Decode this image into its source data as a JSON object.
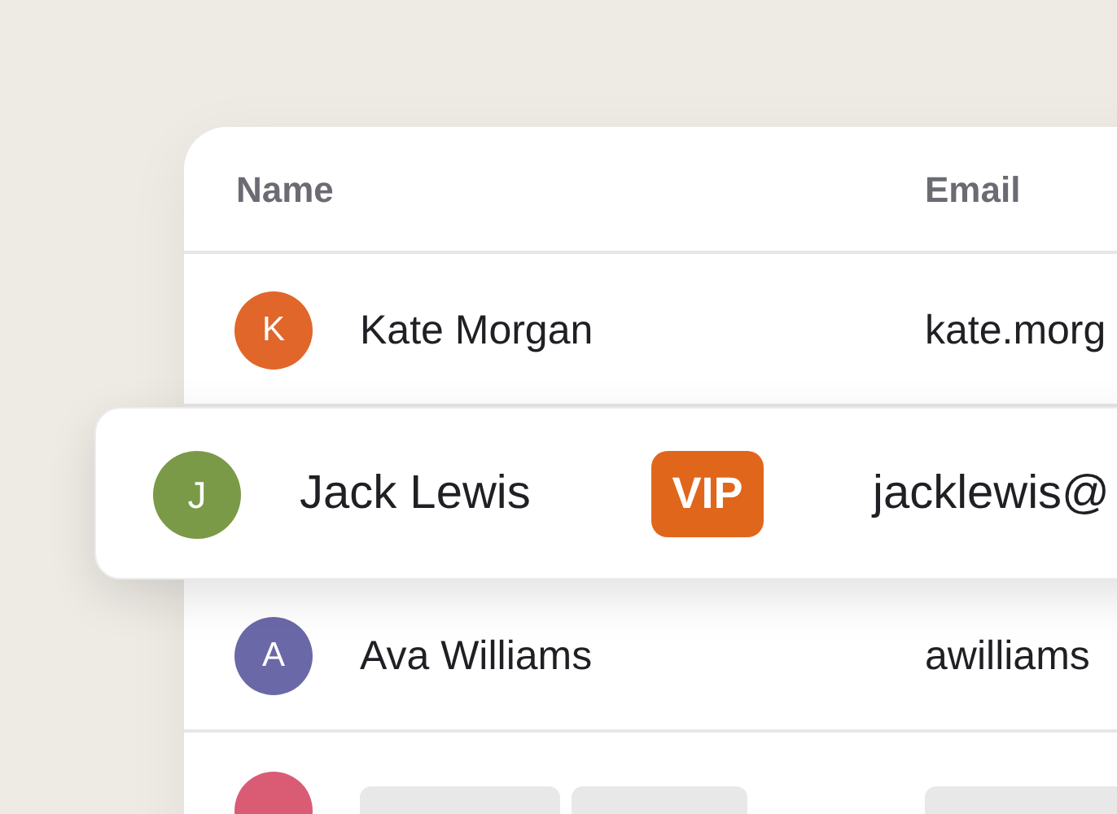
{
  "table": {
    "columns": [
      "Name",
      "Email"
    ],
    "rows": [
      {
        "kind": "contact",
        "initial": "K",
        "name": "Kate Morgan",
        "email": "kate.morg",
        "color": "#e0662a",
        "raised": false
      },
      {
        "kind": "contact",
        "initial": "J",
        "name": "Jack Lewis",
        "email": "jacklewis@",
        "color": "#7a9a48",
        "raised": true,
        "badge": "VIP"
      },
      {
        "kind": "contact",
        "initial": "A",
        "name": "Ava Williams",
        "email": "awilliams",
        "color": "#6b68a8",
        "raised": false
      },
      {
        "kind": "placeholder",
        "color": "#d95c74",
        "raised": false
      }
    ]
  }
}
